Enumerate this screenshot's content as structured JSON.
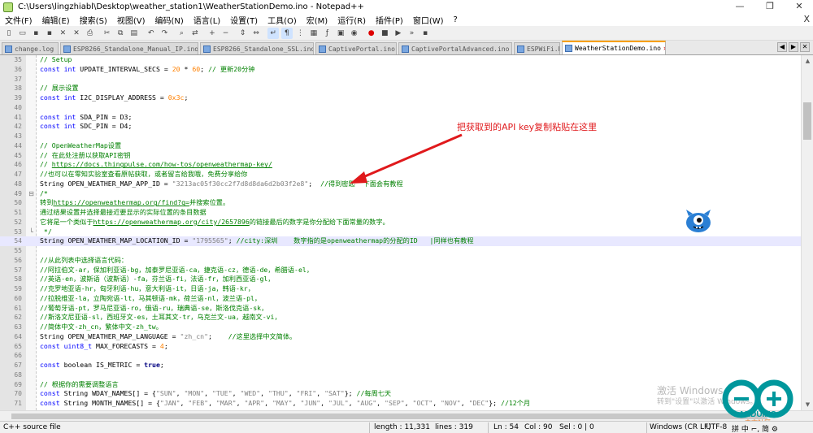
{
  "window": {
    "title": "C:\\Users\\lingzhiabl\\Desktop\\weather_station1\\WeatherStationDemo.ino - Notepad++",
    "controls": [
      "—",
      "❐",
      "✕"
    ]
  },
  "menu": [
    "文件(F)",
    "编辑(E)",
    "搜索(S)",
    "视图(V)",
    "编码(N)",
    "语言(L)",
    "设置(T)",
    "工具(O)",
    "宏(M)",
    "运行(R)",
    "插件(P)",
    "窗口(W)",
    "?"
  ],
  "menu_close": "X",
  "toolbar_icons": [
    "new-file",
    "open-file",
    "save",
    "save-all",
    "close",
    "close-all",
    "print",
    "cut",
    "copy",
    "paste",
    "undo",
    "redo",
    "find",
    "replace",
    "zoom-in",
    "zoom-out",
    "sync-vertical",
    "sync-horizontal",
    "word-wrap",
    "show-all-chars",
    "indent-guide",
    "doc-map",
    "function-list",
    "folder-workspace",
    "monitor",
    "record-macro",
    "stop-record",
    "play-macro",
    "run-macro-multiple",
    "save-macro"
  ],
  "tabs": [
    {
      "label": "change.log",
      "active": false
    },
    {
      "label": "ESP8266_Standalone_Manual_IP.ino",
      "active": false
    },
    {
      "label": "ESP8266_Standalone_SSL.ino",
      "active": false
    },
    {
      "label": "CaptivePortal.ino",
      "active": false
    },
    {
      "label": "CaptivePortalAdvanced.ino",
      "active": false
    },
    {
      "label": "ESPWiFi.h",
      "active": false
    },
    {
      "label": "WeatherStationDemo.ino",
      "active": true
    }
  ],
  "editor": {
    "current_line": 54,
    "lines": [
      {
        "n": 35,
        "segments": [
          [
            "comment",
            "// Setup"
          ]
        ]
      },
      {
        "n": 36,
        "segments": [
          [
            "keyword",
            "const int"
          ],
          [
            "plain",
            " UPDATE_INTERVAL_SECS = "
          ],
          [
            "number",
            "20"
          ],
          [
            "plain",
            " * "
          ],
          [
            "number",
            "60"
          ],
          [
            "plain",
            "; "
          ],
          [
            "comment",
            "// 更新20分钟"
          ]
        ]
      },
      {
        "n": 37,
        "segments": []
      },
      {
        "n": 38,
        "segments": [
          [
            "comment",
            "// 展示设置"
          ]
        ]
      },
      {
        "n": 39,
        "segments": [
          [
            "keyword",
            "const int"
          ],
          [
            "plain",
            " I2C_DISPLAY_ADDRESS = "
          ],
          [
            "number",
            "0x3c"
          ],
          [
            "plain",
            ";"
          ]
        ]
      },
      {
        "n": 40,
        "segments": []
      },
      {
        "n": 41,
        "segments": [
          [
            "keyword",
            "const int"
          ],
          [
            "plain",
            " SDA_PIN = D3;"
          ]
        ]
      },
      {
        "n": 42,
        "segments": [
          [
            "keyword",
            "const int"
          ],
          [
            "plain",
            " SDC_PIN = D4;"
          ]
        ]
      },
      {
        "n": 43,
        "segments": []
      },
      {
        "n": 44,
        "segments": [
          [
            "comment",
            "// OpenWeatherMap设置"
          ]
        ]
      },
      {
        "n": 45,
        "segments": [
          [
            "comment",
            "// 在此处注册以获取API密钥"
          ]
        ]
      },
      {
        "n": 46,
        "segments": [
          [
            "comment",
            "// "
          ],
          [
            "url",
            "https://docs.thingpulse.com/how-tos/openweathermap-key/"
          ]
        ]
      },
      {
        "n": 47,
        "segments": [
          [
            "comment",
            "//也可以在零知实验室查看原帖获取，或者留言给我哦，免费分享给你"
          ]
        ]
      },
      {
        "n": 48,
        "segments": [
          [
            "plain",
            "String OPEN_WEATHER_MAP_APP_ID = "
          ],
          [
            "string",
            "\"3213ac05f30cc2f7d8d8da6d2b03f2e8\""
          ],
          [
            "plain",
            ";  "
          ],
          [
            "comment",
            "//得到密匙  下面会有教程"
          ]
        ]
      },
      {
        "n": 49,
        "fold": "⊟",
        "segments": [
          [
            "comment",
            "/*"
          ]
        ]
      },
      {
        "n": 50,
        "segments": [
          [
            "comment",
            "转到"
          ],
          [
            "url",
            "https://openweathermap.org/find?q="
          ],
          [
            "comment",
            "并搜索位置。"
          ]
        ]
      },
      {
        "n": 51,
        "segments": [
          [
            "comment",
            "通过结果设置并选择最接近要显示的实际位置的条目数据"
          ]
        ]
      },
      {
        "n": 52,
        "segments": [
          [
            "comment",
            "它将是一个类似于"
          ],
          [
            "url",
            "https://openweathermap.org/city/2657896"
          ],
          [
            "comment",
            "的链接最后的数字是你分配给下面常量的数字。"
          ]
        ]
      },
      {
        "n": 53,
        "fold": "└",
        "segments": [
          [
            "comment",
            " */"
          ]
        ]
      },
      {
        "n": 54,
        "segments": [
          [
            "plain",
            "String OPEN_WEATHER_MAP_LOCATION_ID = "
          ],
          [
            "string",
            "\"1795565\""
          ],
          [
            "plain",
            "; "
          ],
          [
            "comment",
            "//city:深圳    数字指的是openweathermap的分配的ID   |同样也有教程"
          ]
        ]
      },
      {
        "n": 55,
        "segments": []
      },
      {
        "n": 56,
        "segments": [
          [
            "comment",
            "//从此列表中选择语言代码："
          ]
        ]
      },
      {
        "n": 57,
        "segments": [
          [
            "comment",
            "//阿拉伯文-ar，保加利亚语-bg，加泰罗尼亚语-ca，捷克语-cz，德语-de，希腊语-el，"
          ]
        ]
      },
      {
        "n": 58,
        "segments": [
          [
            "comment",
            "//英语-en，波斯语（波斯语）-fa，芬兰语-fi，法语-fr，加利西亚语-gl，"
          ]
        ]
      },
      {
        "n": 59,
        "segments": [
          [
            "comment",
            "//克罗地亚语-hr，匈牙利语-hu，意大利语-it，日语-ja，韩语-kr，"
          ]
        ]
      },
      {
        "n": 60,
        "segments": [
          [
            "comment",
            "//拉脱维亚-la，立陶宛语-lt，马其顿语-mk，荷兰语-nl，波兰语-pl，"
          ]
        ]
      },
      {
        "n": 61,
        "segments": [
          [
            "comment",
            "//葡萄牙语-pt，罗马尼亚语-ro，俄语-ru，瑞典语-se，斯洛伐克语-sk，"
          ]
        ]
      },
      {
        "n": 62,
        "segments": [
          [
            "comment",
            "//斯洛文尼亚语-sl，西班牙文-es，土耳其文-tr，乌克兰文-ua，越南文-vi，"
          ]
        ]
      },
      {
        "n": 63,
        "segments": [
          [
            "comment",
            "//简体中文-zh_cn，繁体中文-zh_tw。"
          ]
        ]
      },
      {
        "n": 64,
        "segments": [
          [
            "plain",
            "String OPEN_WEATHER_MAP_LANGUAGE = "
          ],
          [
            "string",
            "\"zh_cn\""
          ],
          [
            "plain",
            ";    "
          ],
          [
            "comment",
            "//这里选择中文简体。"
          ]
        ]
      },
      {
        "n": 65,
        "segments": [
          [
            "keyword",
            "const uint8_t"
          ],
          [
            "plain",
            " MAX_FORECASTS = "
          ],
          [
            "number",
            "4"
          ],
          [
            "plain",
            ";"
          ]
        ]
      },
      {
        "n": 66,
        "segments": []
      },
      {
        "n": 67,
        "segments": [
          [
            "keyword",
            "const"
          ],
          [
            "plain",
            " boolean IS_METRIC = "
          ],
          [
            "bold",
            "true"
          ],
          [
            "plain",
            ";"
          ]
        ]
      },
      {
        "n": 68,
        "segments": []
      },
      {
        "n": 69,
        "segments": [
          [
            "comment",
            "// 根据你的需要调整语言"
          ]
        ]
      },
      {
        "n": 70,
        "segments": [
          [
            "keyword",
            "const"
          ],
          [
            "plain",
            " String WDAY_NAMES[] = {"
          ],
          [
            "string",
            "\"SUN\""
          ],
          [
            "plain",
            ", "
          ],
          [
            "string",
            "\"MON\""
          ],
          [
            "plain",
            ", "
          ],
          [
            "string",
            "\"TUE\""
          ],
          [
            "plain",
            ", "
          ],
          [
            "string",
            "\"WED\""
          ],
          [
            "plain",
            ", "
          ],
          [
            "string",
            "\"THU\""
          ],
          [
            "plain",
            ", "
          ],
          [
            "string",
            "\"FRI\""
          ],
          [
            "plain",
            ", "
          ],
          [
            "string",
            "\"SAT\""
          ],
          [
            "plain",
            "}; "
          ],
          [
            "comment",
            "//每周七天"
          ]
        ]
      },
      {
        "n": 71,
        "segments": [
          [
            "keyword",
            "const"
          ],
          [
            "plain",
            " String MONTH_NAMES[] = {"
          ],
          [
            "string",
            "\"JAN\""
          ],
          [
            "plain",
            ", "
          ],
          [
            "string",
            "\"FEB\""
          ],
          [
            "plain",
            ", "
          ],
          [
            "string",
            "\"MAR\""
          ],
          [
            "plain",
            ", "
          ],
          [
            "string",
            "\"APR\""
          ],
          [
            "plain",
            ", "
          ],
          [
            "string",
            "\"MAY\""
          ],
          [
            "plain",
            ", "
          ],
          [
            "string",
            "\"JUN\""
          ],
          [
            "plain",
            ", "
          ],
          [
            "string",
            "\"JUL\""
          ],
          [
            "plain",
            ", "
          ],
          [
            "string",
            "\"AUG\""
          ],
          [
            "plain",
            ", "
          ],
          [
            "string",
            "\"SEP\""
          ],
          [
            "plain",
            ", "
          ],
          [
            "string",
            "\"OCT\""
          ],
          [
            "plain",
            ", "
          ],
          [
            "string",
            "\"NOV\""
          ],
          [
            "plain",
            ", "
          ],
          [
            "string",
            "\"DEC\""
          ],
          [
            "plain",
            "}; "
          ],
          [
            "comment",
            "//12个月"
          ]
        ]
      }
    ]
  },
  "annotation": {
    "text": "把获取到的API key复制粘贴在这里",
    "color": "#e0191c"
  },
  "status": {
    "file_type": "C++ source file",
    "length": "length : 11,331",
    "lines": "lines : 319",
    "ln": "Ln : 54",
    "col": "Col : 90",
    "sel": "Sel : 0 | 0",
    "eol": "Windows (CR LF)",
    "encoding": "UTF-8",
    "ime": "拼 中 ⌐, 简 ⚙"
  },
  "watermark": {
    "line1": "激活 Windows",
    "line2": "转到\"设置\"以激活 Windows。"
  },
  "logo_text": "ARDUINO",
  "logo_subtext": "中文社区",
  "colors": {
    "comment": "#008000",
    "keyword": "#0000ff",
    "string": "#808080",
    "number": "#ff8000",
    "current_line": "#e8e8ff",
    "tab_accent": "#f7a000"
  }
}
